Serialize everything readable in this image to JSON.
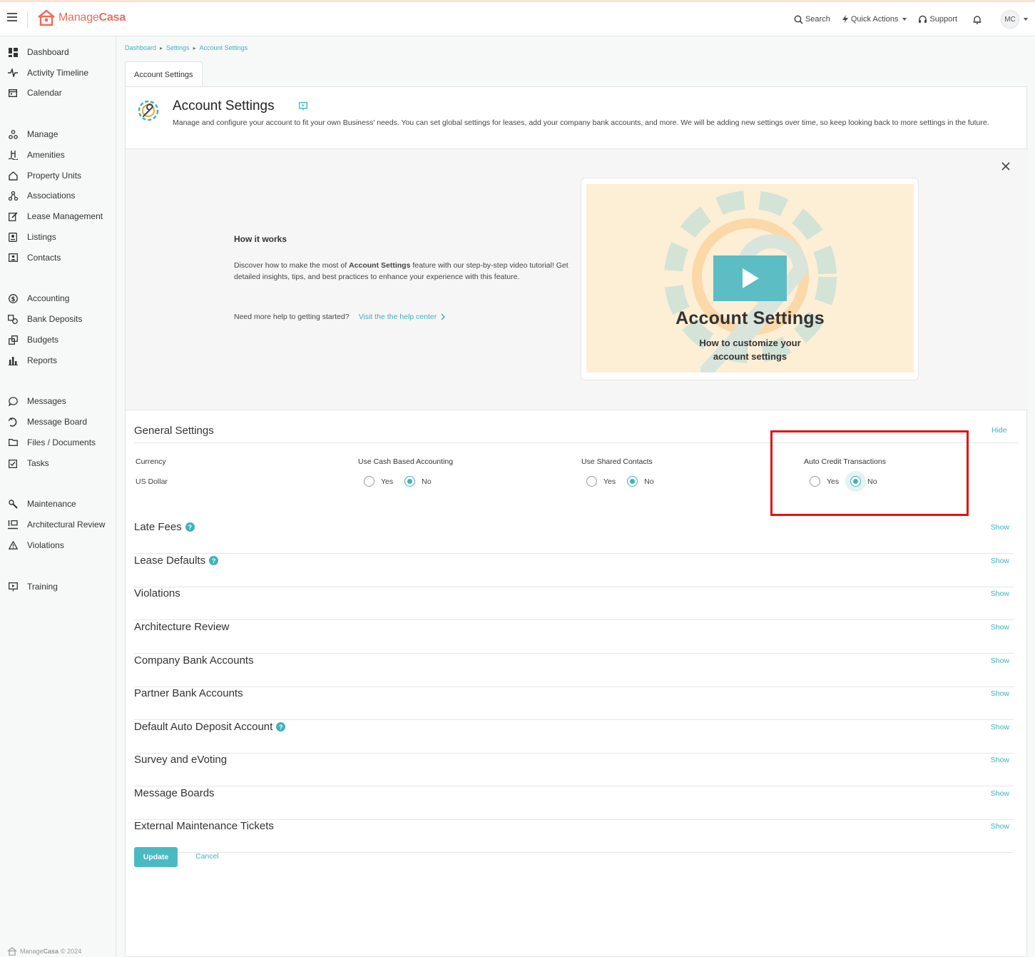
{
  "brand": {
    "name_part1": "Manage",
    "name_part2": "Casa",
    "accent": "#ef6c57",
    "teal": "#3fb2bd"
  },
  "header": {
    "search_label": "Search",
    "quick_actions_label": "Quick Actions",
    "support_label": "Support",
    "avatar_initials": "MC"
  },
  "sidebar": {
    "items": [
      {
        "label": "Dashboard",
        "icon": "dashboard-icon"
      },
      {
        "label": "Activity Timeline",
        "icon": "activity-icon"
      },
      {
        "label": "Calendar",
        "icon": "calendar-icon"
      },
      {
        "label": "Manage",
        "icon": "manage-icon"
      },
      {
        "label": "Amenities",
        "icon": "amenities-icon"
      },
      {
        "label": "Property Units",
        "icon": "home-icon"
      },
      {
        "label": "Associations",
        "icon": "associations-icon"
      },
      {
        "label": "Lease Management",
        "icon": "lease-icon"
      },
      {
        "label": "Listings",
        "icon": "listings-icon"
      },
      {
        "label": "Contacts",
        "icon": "contacts-icon"
      },
      {
        "label": "Accounting",
        "icon": "dollar-icon"
      },
      {
        "label": "Bank Deposits",
        "icon": "bank-deposit-icon"
      },
      {
        "label": "Budgets",
        "icon": "budgets-icon"
      },
      {
        "label": "Reports",
        "icon": "bar-chart-icon"
      },
      {
        "label": "Messages",
        "icon": "message-icon"
      },
      {
        "label": "Message Board",
        "icon": "message-board-icon"
      },
      {
        "label": "Files / Documents",
        "icon": "folder-icon"
      },
      {
        "label": "Tasks",
        "icon": "tasks-icon"
      },
      {
        "label": "Maintenance",
        "icon": "maintenance-icon"
      },
      {
        "label": "Architectural Review",
        "icon": "architectural-icon"
      },
      {
        "label": "Violations",
        "icon": "warning-icon"
      },
      {
        "label": "Training",
        "icon": "training-icon"
      }
    ],
    "footer_brand_1": "Manage",
    "footer_brand_2": "Casa",
    "footer_copyright": "© 2024"
  },
  "breadcrumb": [
    "Dashboard",
    "Settings",
    "Account Settings"
  ],
  "tab_label": "Account Settings",
  "page": {
    "title": "Account Settings",
    "description": "Manage and configure your account to fit your own Business' needs. You can set global settings for leases, add your company bank accounts, and more. We will be adding new settings over time, so keep looking back to more settings in the future."
  },
  "how_it_works": {
    "title": "How it works",
    "desc_before": "Discover how to make the most of ",
    "desc_bold": "Account Settings",
    "desc_after": " feature with our step-by-step video tutorial! Get detailed insights, tips, and best practices to enhance your experience with this feature.",
    "help_text": "Need more help to getting started?",
    "help_link": "Visit the the help center",
    "video_title": "Account Settings",
    "video_subtitle_line1": "How to customize your",
    "video_subtitle_line2": "account settings"
  },
  "general_settings": {
    "title": "General Settings",
    "hide_label": "Hide",
    "currency_label": "Currency",
    "currency_value": "US Dollar",
    "cash_accounting_label": "Use Cash Based Accounting",
    "cash_accounting_value": "No",
    "shared_contacts_label": "Use Shared Contacts",
    "shared_contacts_value": "No",
    "auto_credit_label": "Auto Credit Transactions",
    "auto_credit_value": "No",
    "yes_label": "Yes",
    "no_label": "No"
  },
  "sections": [
    {
      "title": "Late Fees",
      "help": true,
      "action": "Show"
    },
    {
      "title": "Lease Defaults",
      "help": true,
      "action": "Show"
    },
    {
      "title": "Violations",
      "help": false,
      "action": "Show"
    },
    {
      "title": "Architecture Review",
      "help": false,
      "action": "Show"
    },
    {
      "title": "Company Bank Accounts",
      "help": false,
      "action": "Show"
    },
    {
      "title": "Partner Bank Accounts",
      "help": false,
      "action": "Show"
    },
    {
      "title": "Default Auto Deposit Account",
      "help": true,
      "action": "Show"
    },
    {
      "title": "Survey and eVoting",
      "help": false,
      "action": "Show"
    },
    {
      "title": "Message Boards",
      "help": false,
      "action": "Show"
    },
    {
      "title": "External Maintenance Tickets",
      "help": false,
      "action": "Show"
    }
  ],
  "footer_actions": {
    "update_label": "Update",
    "cancel_label": "Cancel"
  }
}
